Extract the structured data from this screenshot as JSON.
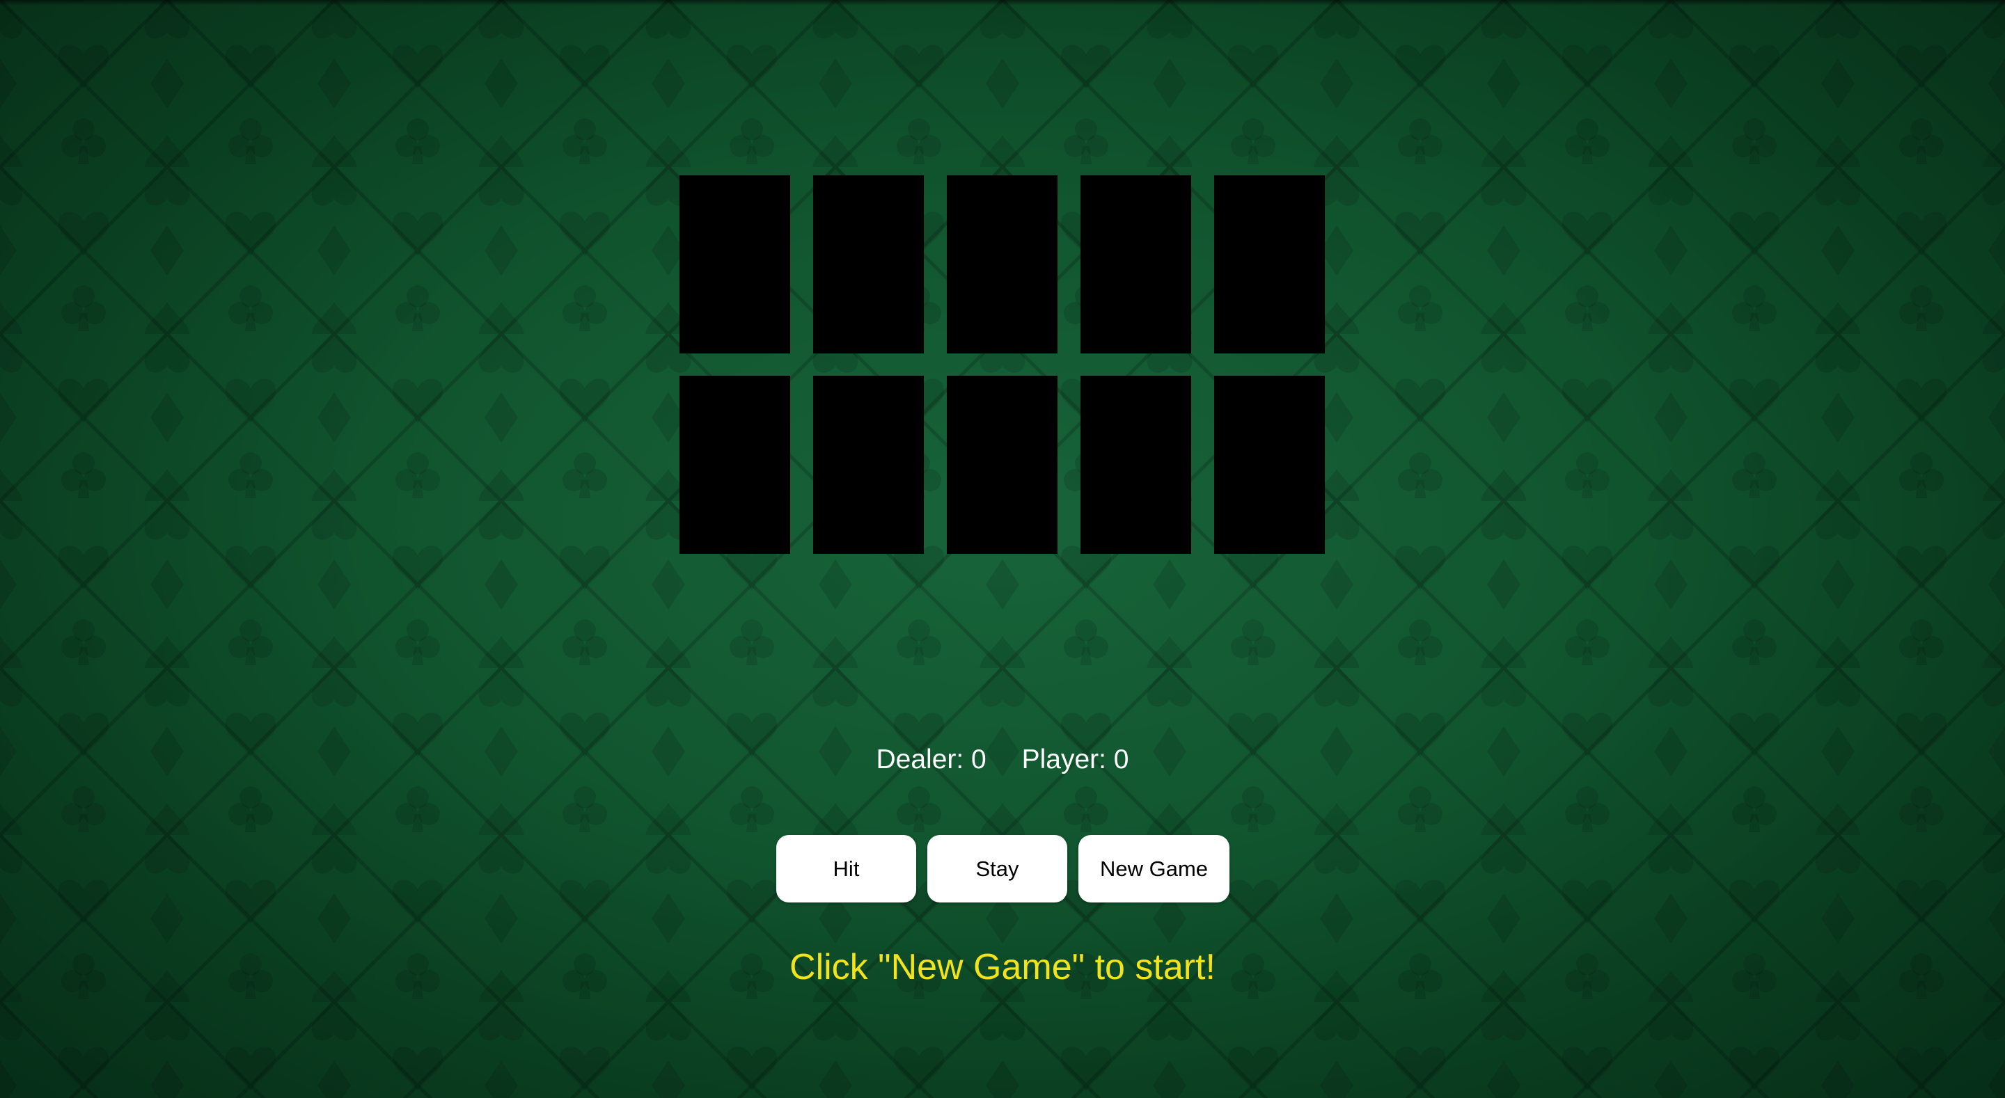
{
  "colors": {
    "felt": "#11562f",
    "card_back": "#000000",
    "button_bg": "#ffffff",
    "message": "#f2e31a",
    "score_text": "#ffffff"
  },
  "background": {
    "pattern_icons": [
      "spade-icon",
      "heart-icon",
      "diamond-icon",
      "club-icon"
    ]
  },
  "dealer": {
    "cards": [
      "empty",
      "empty",
      "empty",
      "empty",
      "empty"
    ]
  },
  "player": {
    "cards": [
      "empty",
      "empty",
      "empty",
      "empty",
      "empty"
    ]
  },
  "scores": {
    "dealer_label": "Dealer: 0",
    "player_label": "Player: 0"
  },
  "controls": {
    "hit_label": "Hit",
    "stay_label": "Stay",
    "new_game_label": "New Game"
  },
  "message": "Click \"New Game\" to start!"
}
